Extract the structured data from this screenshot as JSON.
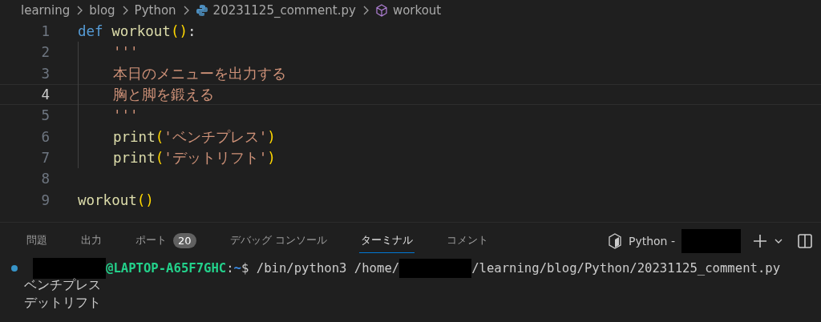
{
  "breadcrumb": [
    {
      "label": "learning",
      "kind": "folder"
    },
    {
      "label": "blog",
      "kind": "folder"
    },
    {
      "label": "Python",
      "kind": "folder"
    },
    {
      "label": "20231125_comment.py",
      "kind": "file"
    },
    {
      "label": "workout",
      "kind": "symbol"
    }
  ],
  "code": [
    {
      "number": "1",
      "current": false,
      "tokens": [
        {
          "kind": "keyword",
          "text": "def"
        },
        {
          "kind": "func",
          "text": "workout"
        },
        {
          "kind": "paren",
          "text": "()"
        },
        {
          "kind": "plain",
          "text": ":"
        }
      ],
      "children": [
        {
          "number": "2",
          "current": false,
          "tokens": [
            {
              "kind": "string",
              "text": "'''"
            }
          ]
        },
        {
          "number": "3",
          "current": false,
          "tokens": [
            {
              "kind": "string",
              "text": "本日のメニューを出力する"
            }
          ]
        },
        {
          "number": "4",
          "current": true,
          "tokens": [
            {
              "kind": "string",
              "text": "胸と脚を鍛える"
            }
          ]
        },
        {
          "number": "5",
          "current": false,
          "tokens": [
            {
              "kind": "string",
              "text": "'''"
            }
          ]
        },
        {
          "number": "6",
          "current": false,
          "tokens": [
            {
              "kind": "func",
              "text": "print"
            },
            {
              "kind": "paren",
              "text": "("
            },
            {
              "kind": "string",
              "text": "'ベンチプレス'"
            },
            {
              "kind": "paren",
              "text": ")"
            }
          ]
        },
        {
          "number": "7",
          "current": false,
          "tokens": [
            {
              "kind": "func",
              "text": "print"
            },
            {
              "kind": "paren",
              "text": "("
            },
            {
              "kind": "string",
              "text": "'デットリフト'"
            },
            {
              "kind": "paren",
              "text": ")"
            }
          ]
        }
      ]
    },
    {
      "number": "8",
      "current": false
    },
    {
      "number": "9",
      "current": false,
      "tokens": [
        {
          "kind": "func",
          "text": "workout"
        },
        {
          "kind": "paren",
          "text": "()"
        }
      ]
    }
  ],
  "panel_tabs": [
    {
      "label": "問題",
      "selected": false
    },
    {
      "label": "出力",
      "selected": false
    },
    {
      "label": "ポート",
      "selected": false,
      "badge": "20"
    },
    {
      "label": "デバッグ コンソール",
      "selected": false
    },
    {
      "label": "ターミナル",
      "selected": true
    },
    {
      "label": "コメント",
      "selected": false
    }
  ],
  "terminal_profile": "Python -",
  "terminal": {
    "host": "@LAPTOP-A65F7GHC",
    "sep": ":",
    "dir": "~",
    "command_start": "$ /bin/python3 /home/",
    "command_end": "/learning/blog/Python/20231125_comment.py",
    "output": [
      "ベンチプレス",
      "デットリフト"
    ]
  }
}
